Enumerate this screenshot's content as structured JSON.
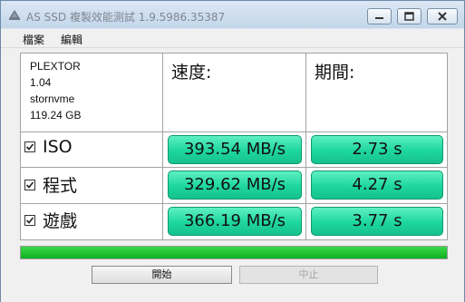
{
  "window": {
    "title": "AS SSD 複製效能測試 1.9.5986.35387"
  },
  "menu": {
    "file": "檔案",
    "edit": "編輯"
  },
  "drive": {
    "model": "PLEXTOR",
    "firmware": "1.04",
    "driver": "stornvme",
    "capacity": "119.24 GB"
  },
  "headers": {
    "speed": "速度:",
    "time": "期間:"
  },
  "rows": [
    {
      "label": "ISO",
      "checked": true,
      "speed": "393.54 MB/s",
      "time": "2.73 s"
    },
    {
      "label": "程式",
      "checked": true,
      "speed": "329.62 MB/s",
      "time": "4.27 s"
    },
    {
      "label": "遊戲",
      "checked": true,
      "speed": "366.19 MB/s",
      "time": "3.77 s"
    }
  ],
  "progress": {
    "value_percent": 100,
    "color": "#17b427"
  },
  "buttons": {
    "start": "開始",
    "stop": "中止"
  },
  "colors": {
    "result_cell": "#1dd69e"
  }
}
